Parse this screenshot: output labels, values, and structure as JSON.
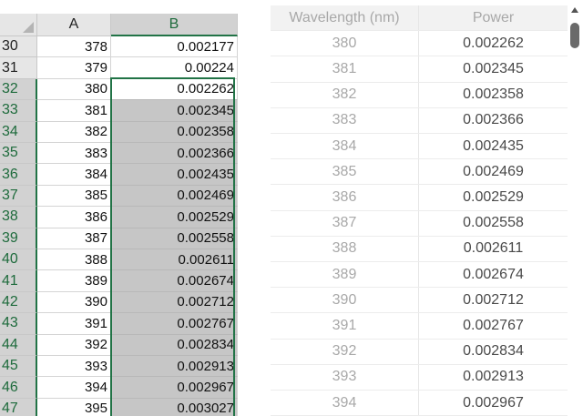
{
  "sheet": {
    "columns": [
      "A",
      "B"
    ],
    "rows": [
      {
        "num": "30",
        "a": "378",
        "b": "0.002177"
      },
      {
        "num": "31",
        "a": "379",
        "b": "0.00224"
      },
      {
        "num": "32",
        "a": "380",
        "b": "0.002262"
      },
      {
        "num": "33",
        "a": "381",
        "b": "0.002345"
      },
      {
        "num": "34",
        "a": "382",
        "b": "0.002358"
      },
      {
        "num": "35",
        "a": "383",
        "b": "0.002366"
      },
      {
        "num": "36",
        "a": "384",
        "b": "0.002435"
      },
      {
        "num": "37",
        "a": "385",
        "b": "0.002469"
      },
      {
        "num": "38",
        "a": "386",
        "b": "0.002529"
      },
      {
        "num": "39",
        "a": "387",
        "b": "0.002558"
      },
      {
        "num": "40",
        "a": "388",
        "b": "0.002611"
      },
      {
        "num": "41",
        "a": "389",
        "b": "0.002674"
      },
      {
        "num": "42",
        "a": "390",
        "b": "0.002712"
      },
      {
        "num": "43",
        "a": "391",
        "b": "0.002767"
      },
      {
        "num": "44",
        "a": "392",
        "b": "0.002834"
      },
      {
        "num": "45",
        "a": "393",
        "b": "0.002913"
      },
      {
        "num": "46",
        "a": "394",
        "b": "0.002967"
      },
      {
        "num": "47",
        "a": "395",
        "b": "0.003027"
      }
    ],
    "selection": {
      "column": "B",
      "first_row": "32",
      "active_row": "32"
    }
  },
  "table": {
    "headers": [
      "Wavelength (nm)",
      "Power"
    ],
    "rows": [
      [
        "380",
        "0.002262"
      ],
      [
        "381",
        "0.002345"
      ],
      [
        "382",
        "0.002358"
      ],
      [
        "383",
        "0.002366"
      ],
      [
        "384",
        "0.002435"
      ],
      [
        "385",
        "0.002469"
      ],
      [
        "386",
        "0.002529"
      ],
      [
        "387",
        "0.002558"
      ],
      [
        "388",
        "0.002611"
      ],
      [
        "389",
        "0.002674"
      ],
      [
        "390",
        "0.002712"
      ],
      [
        "391",
        "0.002767"
      ],
      [
        "392",
        "0.002834"
      ],
      [
        "393",
        "0.002913"
      ],
      [
        "394",
        "0.002967"
      ]
    ]
  },
  "colors": {
    "selection_green": "#217346",
    "selection_fill": "#c6c6c6",
    "header_fill": "#e6e6e6"
  }
}
